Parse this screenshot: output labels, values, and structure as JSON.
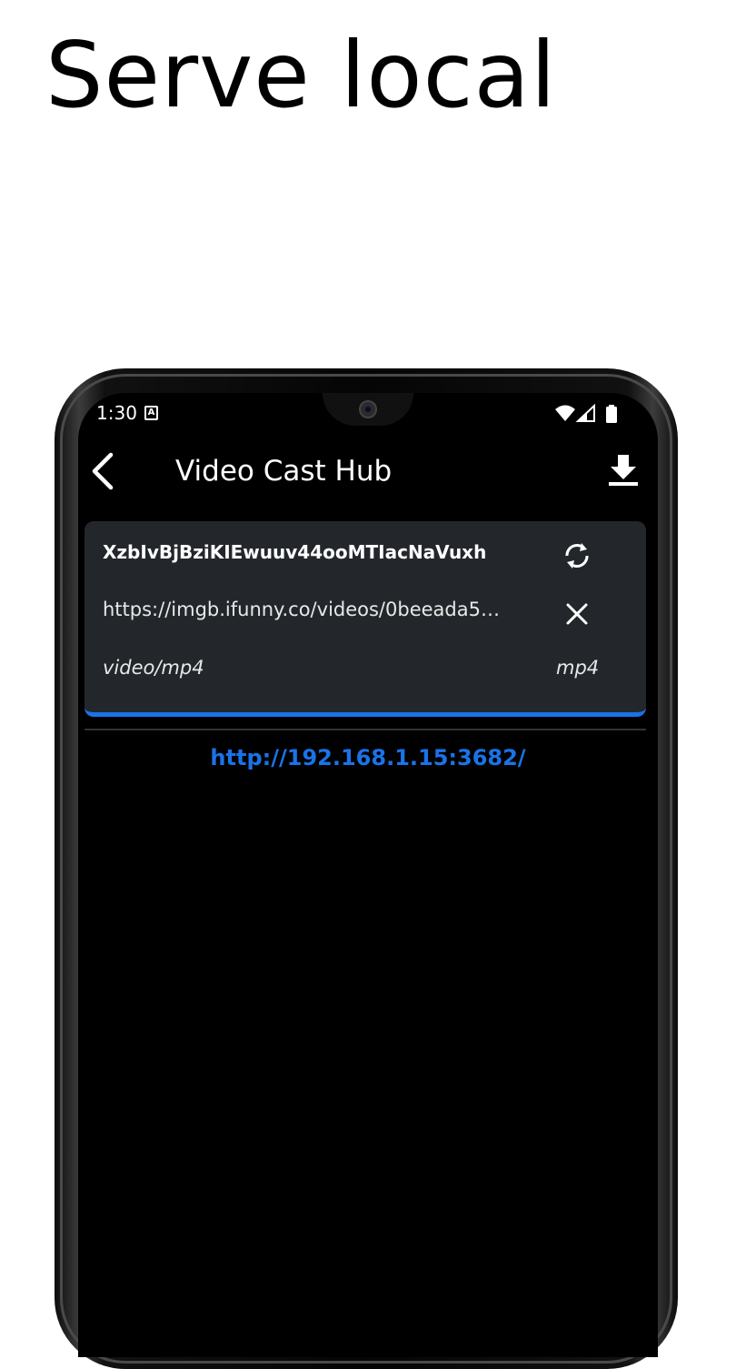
{
  "headline": "Serve local",
  "status_bar": {
    "time": "1:30",
    "notification_icon": "a-icon",
    "right_icons": [
      "wifi-icon",
      "signal-icon",
      "battery-icon"
    ]
  },
  "app_bar": {
    "title": "Video Cast Hub",
    "back_icon": "back-arrow-icon",
    "action_icon": "download-icon"
  },
  "media_card": {
    "title": "XzbIvBjBziKIEwuuv44ooMTIacNaVuxh",
    "url": "https://imgb.ifunny.co/videos/0beeada5…",
    "mime_type": "video/mp4",
    "extension": "mp4",
    "refresh_icon": "refresh-icon",
    "remove_icon": "close-icon",
    "accent_color": "#1a73e8"
  },
  "server": {
    "address": "http://192.168.1.15:3682/"
  },
  "colors": {
    "background": "#000000",
    "card": "#23272b",
    "accent": "#1a73e8",
    "text": "#ffffff"
  }
}
